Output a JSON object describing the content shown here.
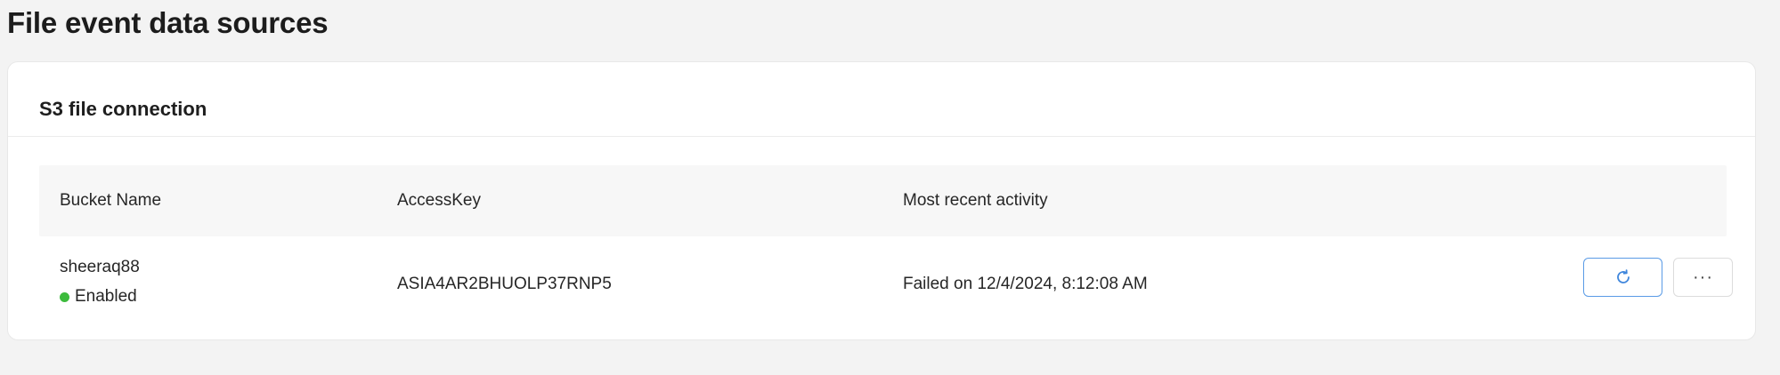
{
  "page": {
    "title": "File event data sources"
  },
  "card": {
    "title": "S3 file connection"
  },
  "table": {
    "columns": [
      "Bucket Name",
      "AccessKey",
      "Most recent activity"
    ],
    "rows": [
      {
        "bucket_name": "sheeraq88",
        "status": "Enabled",
        "status_color": "#3dbb3d",
        "access_key": "ASIA4AR2BHUOLP37RNP5",
        "recent_activity": "Failed on 12/4/2024, 8:12:08 AM"
      }
    ]
  },
  "actions": {
    "refresh_icon": "refresh-icon",
    "more_label": "···"
  },
  "colors": {
    "accent": "#5a9be6",
    "background": "#f3f3f3",
    "card": "#ffffff"
  }
}
